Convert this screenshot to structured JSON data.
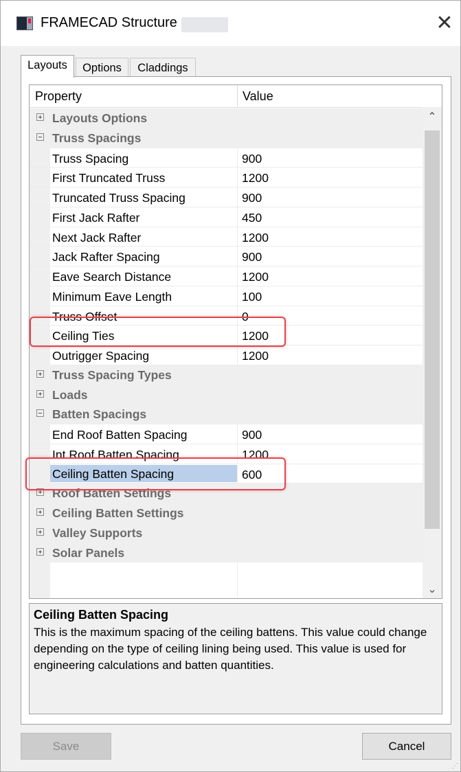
{
  "window": {
    "title": "FRAMECAD Structure"
  },
  "tabs": [
    {
      "label": "Layouts",
      "active": true
    },
    {
      "label": "Options",
      "active": false
    },
    {
      "label": "Claddings",
      "active": false
    }
  ],
  "grid": {
    "header": {
      "property": "Property",
      "value": "Value"
    },
    "rows": [
      {
        "kind": "category",
        "expanded": false,
        "label": "Layouts  Options"
      },
      {
        "kind": "category",
        "expanded": true,
        "label": "Truss Spacings"
      },
      {
        "kind": "item",
        "property": "Truss Spacing",
        "value": "900"
      },
      {
        "kind": "item",
        "property": "First Truncated Truss",
        "value": "1200"
      },
      {
        "kind": "item",
        "property": "Truncated Truss Spacing",
        "value": "900"
      },
      {
        "kind": "item",
        "property": "First Jack Rafter",
        "value": "450"
      },
      {
        "kind": "item",
        "property": "Next Jack Rafter",
        "value": "1200"
      },
      {
        "kind": "item",
        "property": "Jack Rafter Spacing",
        "value": "900"
      },
      {
        "kind": "item",
        "property": "Eave Search Distance",
        "value": "1200"
      },
      {
        "kind": "item",
        "property": "Minimum Eave Length",
        "value": "100"
      },
      {
        "kind": "item",
        "property": "Truss Offset",
        "value": "0"
      },
      {
        "kind": "item",
        "property": "Ceiling Ties",
        "value": "1200"
      },
      {
        "kind": "item",
        "property": "Outrigger Spacing",
        "value": "1200"
      },
      {
        "kind": "category",
        "expanded": false,
        "label": "Truss Spacing Types"
      },
      {
        "kind": "category",
        "expanded": false,
        "label": "Loads"
      },
      {
        "kind": "category",
        "expanded": true,
        "label": "Batten Spacings"
      },
      {
        "kind": "item",
        "property": "End Roof Batten Spacing",
        "value": "900"
      },
      {
        "kind": "item",
        "property": "Int Roof Batten Spacing",
        "value": "1200"
      },
      {
        "kind": "item",
        "property": "Ceiling Batten Spacing",
        "value": "600",
        "selected": true
      },
      {
        "kind": "category",
        "expanded": false,
        "label": "Roof Batten Settings"
      },
      {
        "kind": "category",
        "expanded": false,
        "label": "Ceiling Batten Settings"
      },
      {
        "kind": "category",
        "expanded": false,
        "label": "Valley Supports"
      },
      {
        "kind": "category",
        "expanded": false,
        "label": "Solar Panels"
      }
    ]
  },
  "help": {
    "title": "Ceiling Batten Spacing",
    "text": "This is the maximum spacing of the ceiling battens.  This value could change depending on the type of ceiling lining being used. This value is used for engineering calculations and batten quantities."
  },
  "buttons": {
    "save": "Save",
    "cancel": "Cancel"
  },
  "colors": {
    "highlight": "#e0464d",
    "selection": "#b9cfea"
  }
}
